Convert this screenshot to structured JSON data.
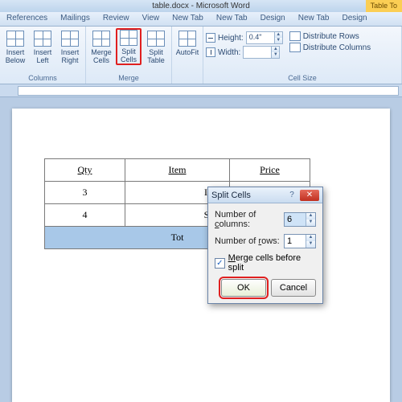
{
  "window": {
    "title": "table.docx - Microsoft Word",
    "tool_tab": "Table To"
  },
  "tabs": [
    "References",
    "Mailings",
    "Review",
    "View",
    "New Tab",
    "New Tab",
    "Design",
    "New Tab",
    "Design"
  ],
  "ribbon": {
    "rows_cols": {
      "insert_below": "Insert Below",
      "insert_left": "Insert Left",
      "insert_right": "Insert Right",
      "group": "Columns"
    },
    "merge": {
      "merge_cells": "Merge Cells",
      "split_cells": "Split Cells",
      "split_table": "Split Table",
      "group": "Merge"
    },
    "autofit": "AutoFit",
    "cellsize": {
      "height_label": "Height:",
      "height_val": "0.4\"",
      "width_label": "Width:",
      "width_val": "",
      "dist_rows": "Distribute Rows",
      "dist_cols": "Distribute Columns",
      "group": "Cell Size"
    }
  },
  "table": {
    "headers": [
      "Qty",
      "Item",
      "Price"
    ],
    "rows": [
      {
        "qty": "3",
        "item": "Ice cr"
      },
      {
        "qty": "4",
        "item": "Sham"
      }
    ],
    "total_label": "Tot"
  },
  "dialog": {
    "title": "Split Cells",
    "cols_label_pre": "Number of ",
    "cols_label_u": "c",
    "cols_label_post": "olumns:",
    "rows_label_pre": "Number of ",
    "rows_label_u": "r",
    "rows_label_post": "ows:",
    "cols_val": "6",
    "rows_val": "1",
    "merge_label_u": "M",
    "merge_label_post": "erge cells before split",
    "ok": "OK",
    "cancel": "Cancel"
  }
}
